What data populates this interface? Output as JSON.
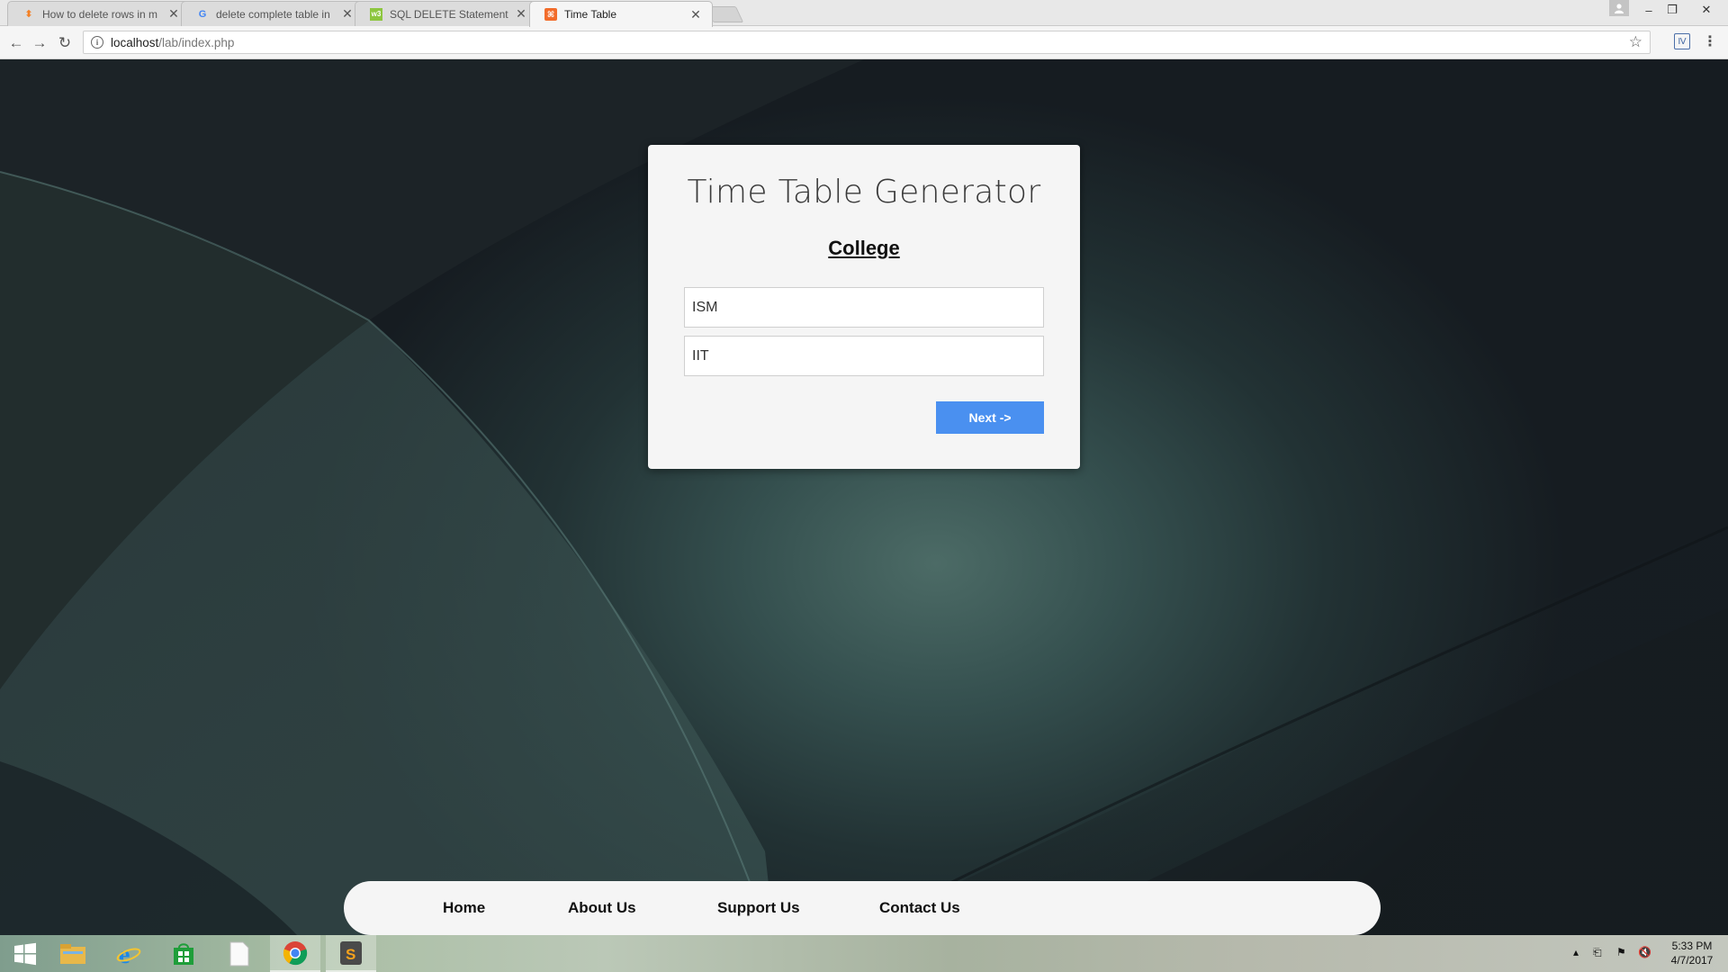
{
  "browser": {
    "tabs": [
      {
        "title": "How to delete rows in m",
        "favicon": "stackoverflow-icon",
        "color": "#f48024",
        "active": false
      },
      {
        "title": "delete complete table in",
        "favicon": "google-icon",
        "color": "#4285f4",
        "active": false
      },
      {
        "title": "SQL DELETE Statement",
        "favicon": "w3schools-icon",
        "color": "#8dc63f",
        "active": false
      },
      {
        "title": "Time Table",
        "favicon": "xampp-icon",
        "color": "#f26c2b",
        "active": true
      }
    ],
    "url_host": "localhost",
    "url_path": "/lab/index.php"
  },
  "page": {
    "title": "Time Table Generator",
    "section_heading": "College",
    "fields": [
      {
        "value": "ISM"
      },
      {
        "value": "IIT"
      }
    ],
    "next_label": "Next ->",
    "accent": "#4a90f0"
  },
  "footer_nav": [
    "Home",
    "About Us",
    "Support Us",
    "Contact Us"
  ],
  "taskbar": {
    "apps": [
      "start-icon",
      "file-explorer-icon",
      "internet-explorer-icon",
      "store-icon",
      "notepad-icon",
      "chrome-icon",
      "sublime-text-icon"
    ],
    "time": "5:33 PM",
    "date": "4/7/2017"
  }
}
